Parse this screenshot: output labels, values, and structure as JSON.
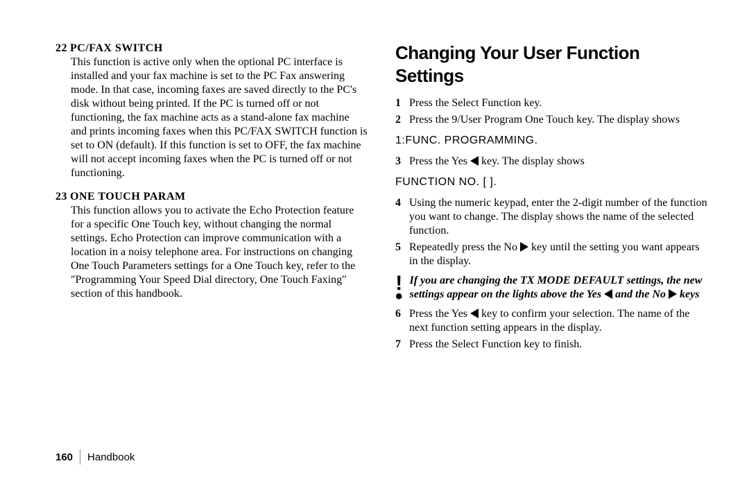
{
  "left": {
    "items": [
      {
        "num": "22",
        "head": "PC/FAX SWITCH",
        "body": "This function is active only when the optional PC interface is installed and your fax machine is set to the PC Fax answering mode. In that case, incoming faxes are saved directly to the PC's disk without being printed. If the PC is turned off or not functioning, the fax machine acts as a stand-alone fax machine and prints incoming faxes when this PC/FAX SWITCH function is set to ON (default). If this function is set to OFF, the fax machine will not accept incoming faxes when the PC is turned off or not functioning."
      },
      {
        "num": "23",
        "head": "ONE TOUCH PARAM",
        "body": "This function allows you to activate the Echo Protection feature for a specific One Touch key, without changing the normal settings. Echo Protection can improve communication with a location in a noisy telephone area. For instructions on changing One Touch Parameters settings for a One Touch key, refer to the \"Programming Your Speed Dial directory, One Touch Faxing\" section of this handbook."
      }
    ]
  },
  "right": {
    "title": "Changing Your User Function Settings",
    "steps_a": [
      {
        "n": "1",
        "t": "Press the Select Function key."
      },
      {
        "n": "2",
        "t": "Press the 9/User Program One Touch key. The display shows"
      }
    ],
    "lcd1": "1:FUNC. PROGRAMMING.",
    "step3_pre": "Press the Yes ",
    "step3_post": " key. The display shows",
    "lcd2": "FUNCTION NO. [ ].",
    "step4": "Using the numeric keypad, enter the 2-digit number of the function you want to change. The display shows the name of the selected function.",
    "step5_pre": "Repeatedly press the No ",
    "step5_post": " key until the setting you want appears in the display.",
    "note_pre": "If you are changing the TX MODE DEFAULT settings, the new settings appear on the lights above the Yes ",
    "note_mid": " and the No ",
    "note_post": " keys",
    "step6_pre": "Press the Yes ",
    "step6_post": " key to confirm your selection. The name of the next function setting appears in the display.",
    "step7": "Press the Select Function key to finish."
  },
  "footer": {
    "page": "160",
    "book": "Handbook"
  }
}
